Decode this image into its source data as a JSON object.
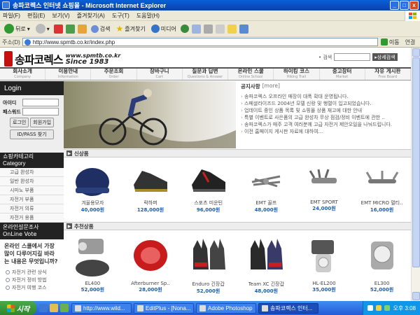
{
  "window": {
    "title": "송파코렉스 인터넷 쇼핑몰 - Microsoft Internet Explorer",
    "min": "_",
    "max": "□",
    "close": "x"
  },
  "menu": [
    "파일(F)",
    "편집(E)",
    "보기(V)",
    "즐겨찾기(A)",
    "도구(T)",
    "도움말(H)"
  ],
  "toolbar": {
    "back": "뒤로",
    "search": "검색",
    "favorites": "즐겨찾기",
    "media": "미디어"
  },
  "address": {
    "label": "주소(D)",
    "url": "http://www.spmtb.co.kr/index.php",
    "go": "이동",
    "links": "연결"
  },
  "site": {
    "logo_name": "송파코렉스",
    "logo_url": "www.spmtb.co.kr",
    "logo_since": "Since 1983",
    "search_label": "• 검색",
    "search_button": "상세검색",
    "nav": [
      {
        "k": "회사소개",
        "e": "Company"
      },
      {
        "k": "이용안내",
        "e": "Information"
      },
      {
        "k": "주문조회",
        "e": "Order"
      },
      {
        "k": "장바구니",
        "e": "Cart"
      },
      {
        "k": "질문과 답변",
        "e": "Questions & Answer"
      },
      {
        "k": "온라인 스쿨",
        "e": "Online School"
      },
      {
        "k": "하이킹 코스",
        "e": "Hiking Trail"
      },
      {
        "k": "중고장터",
        "e": "Market"
      },
      {
        "k": "자유 게시판",
        "e": "Free Board"
      }
    ],
    "login": {
      "title": "Login",
      "id_label": "아이디",
      "pw_label": "패스워드",
      "login_btn": "로그인",
      "join_btn": "회원가입",
      "find_btn": "ID/PASS 찾기"
    },
    "category": {
      "title_ko": "쇼핑카테고리",
      "title_en": "Category",
      "items": [
        "고급 완성차",
        "일반 완성차",
        "시마노 부품",
        "자전거 부품",
        "자전거 의류",
        "자전거 용품"
      ]
    },
    "vote": {
      "title_ko": "온라인설문조사",
      "title_en": "OnLine Vote",
      "question": "온라인 스쿨에서 가장 많이 다루어지길 바라는 내용은 무엇입니까?",
      "options": [
        "자전거 관련 상식",
        "자전거 정비 방법",
        "자전거 여행 코스"
      ]
    },
    "notice": {
      "title": "공지사항",
      "more": "[more]",
      "items": [
        "송파코렉스 오프라인 매장이 대폭 확대 운영됩니다.",
        "스페셜라이즈드 2004년 모델 신랑 및 행렬이 입고되었습니다.",
        "업데이트 중인 상품 목록 및 쇼핑몰 상품 재고에 대한 안내",
        "특별 이벤트로 사은품의 고급 완성차 무상 점검/정비 이벤트에 관한 ..",
        "송파코렉스가 매주 고객 여러분께 고급 자전거 제안오일을 나눠드립니다.",
        "이전 홈페이지 게시판 자료에 대하여..."
      ]
    },
    "new_section": "신상품",
    "rec_section": "추천상품",
    "new_products": [
      {
        "name": "겨울용모자",
        "price": "40,000원"
      },
      {
        "name": "락하퍼",
        "price": "128,000원"
      },
      {
        "name": "스포츠 미운틴",
        "price": "96,000원"
      },
      {
        "name": "EMT 꼴프",
        "price": "48,000원"
      },
      {
        "name": "EMT SPORT",
        "price": "24,000원"
      },
      {
        "name": "EMT MICRO 멀티..",
        "price": "16,000원"
      }
    ],
    "rec_products": [
      {
        "name": "EL400",
        "price": "52,000원"
      },
      {
        "name": "Afterburner Sp..",
        "price": "28,000원"
      },
      {
        "name": "Enduro 긴장갑",
        "price": "52,000원"
      },
      {
        "name": "Team XC 긴장갑",
        "price": "48,000원"
      },
      {
        "name": "HL-EL200",
        "price": "35,000원"
      },
      {
        "name": "EL300",
        "price": "52,000원"
      }
    ]
  },
  "taskbar": {
    "start": "시작",
    "tasks": [
      "http://www.wild...",
      "EditPlus - [Nona...",
      "Adobe Photoshop",
      "송파코렉스 인터..."
    ],
    "clock": "오후 3:08"
  },
  "colors": {
    "accent": "#1a5fb4",
    "logo_red": "#c41010"
  }
}
